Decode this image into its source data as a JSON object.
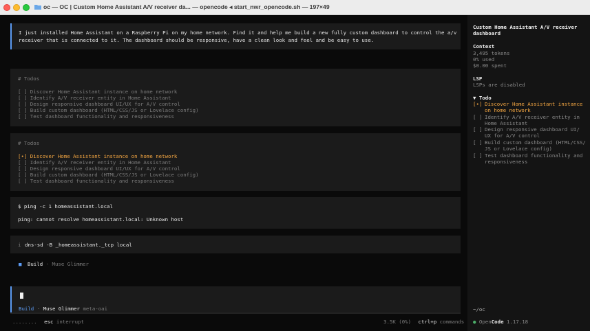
{
  "window": {
    "title": "oc — OC | Custom Home Assistant A/V receiver da... — opencode ◂ start_nwr_opencode.sh — 197×49"
  },
  "user_message": {
    "line1": "I just installed Home Assistant on a Raspberry Pi on my home network. Find it and help me build a new fully custom dashboard to control the a/v",
    "line2": "receiver that is connected to it. The dashboard should be responsive, have a clean look and feel and be easy to use."
  },
  "todos1": {
    "header": "# Todos",
    "items": [
      "[ ] Discover Home Assistant instance on home network",
      "[ ] Identify A/V receiver entity in Home Assistant",
      "[ ] Design responsive dashboard UI/UX for A/V control",
      "[ ] Build custom dashboard (HTML/CSS/JS or Lovelace config)",
      "[ ] Test dashboard functionality and responsiveness"
    ]
  },
  "todos2": {
    "header": "# Todos",
    "items": [
      "[•] Discover Home Assistant instance on home network",
      "[ ] Identify A/V receiver entity in Home Assistant",
      "[ ] Design responsive dashboard UI/UX for A/V control",
      "[ ] Build custom dashboard (HTML/CSS/JS or Lovelace config)",
      "[ ] Test dashboard functionality and responsiveness"
    ]
  },
  "ping": {
    "command": "$ ping -c 1 homeassistant.local",
    "output": "ping: cannot resolve homeassistant.local: Unknown host"
  },
  "dns": {
    "prefix": "i",
    "command": "dns-sd -B _homeassistant._tcp local"
  },
  "build_status": {
    "icon": "■",
    "mode": "Build",
    "sep": "·",
    "agent": "Muse Glimmer"
  },
  "input": {
    "mode": "Build",
    "sep": "·",
    "agent": "Muse Glimmer",
    "model": "meta-oai"
  },
  "footer": {
    "dots": "........",
    "esc_key": "esc",
    "esc_label": "interrupt",
    "tokens": "3.5K (0%)",
    "cmd_key": "ctrl+p",
    "cmd_label": "commands"
  },
  "sidebar": {
    "title_line1": "Custom Home Assistant A/V receiver",
    "title_line2": "dashboard",
    "context_heading": "Context",
    "tokens": "3,495 tokens",
    "used": "0% used",
    "spent": "$0.00 spent",
    "lsp_heading": "LSP",
    "lsp_status": "LSPs are disabled",
    "todo_heading": "▼ Todo",
    "todo_items": [
      {
        "mark": "[•]",
        "l1": "Discover Home Assistant instance",
        "l2": "on home network"
      },
      {
        "mark": "[ ]",
        "l1": "Identify A/V receiver entity in",
        "l2": "Home Assistant"
      },
      {
        "mark": "[ ]",
        "l1": "Design responsive dashboard UI/",
        "l2": "UX for A/V control"
      },
      {
        "mark": "[ ]",
        "l1": "Build custom dashboard (HTML/CSS/",
        "l2": "JS or Lovelace config)"
      },
      {
        "mark": "[ ]",
        "l1": "Test dashboard functionality and",
        "l2": "responsiveness"
      }
    ],
    "cwd": "~/oc",
    "app_dot": "●",
    "app_name_a": "Open",
    "app_name_b": "Code",
    "version": "1.17.18"
  },
  "colors": {
    "accent_blue": "#5c9cf5",
    "active_orange": "#f5a742",
    "status_green": "#4caf6a"
  }
}
